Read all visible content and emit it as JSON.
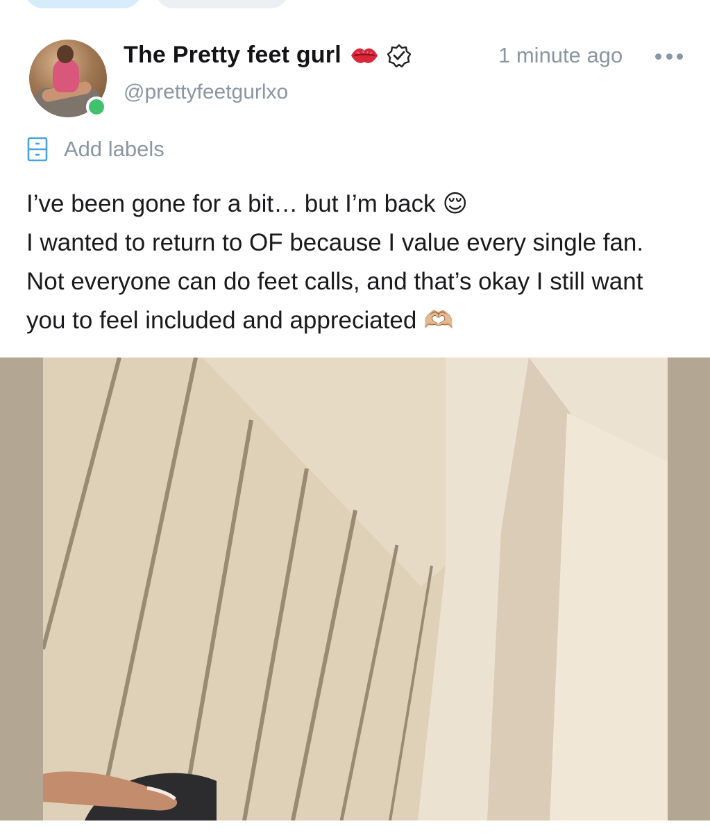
{
  "post": {
    "author": {
      "display_name": "The Pretty feet gurl",
      "handle": "@prettyfeetgurlxo",
      "online": true
    },
    "timestamp": "1 minute ago",
    "labels_action": "Add labels",
    "text_lines": [
      "I’ve been gone for a bit… but I’m back",
      "I wanted to return to OF because I value every single fan.",
      "Not everyone can do feet calls, and that’s okay I still want",
      "you to feel included and appreciated"
    ],
    "emojis": {
      "line1": "😌",
      "line4": "🫶🏼"
    }
  },
  "icons": {
    "lips": "kiss-mark-icon",
    "verified": "verified-badge-icon",
    "more": "more-options-icon",
    "labels": "label-icon"
  },
  "colors": {
    "accent_blue": "#00aff0",
    "muted_text": "#8a96a3",
    "online_green": "#3fc26b",
    "active_tab": "#d6ecfb"
  }
}
